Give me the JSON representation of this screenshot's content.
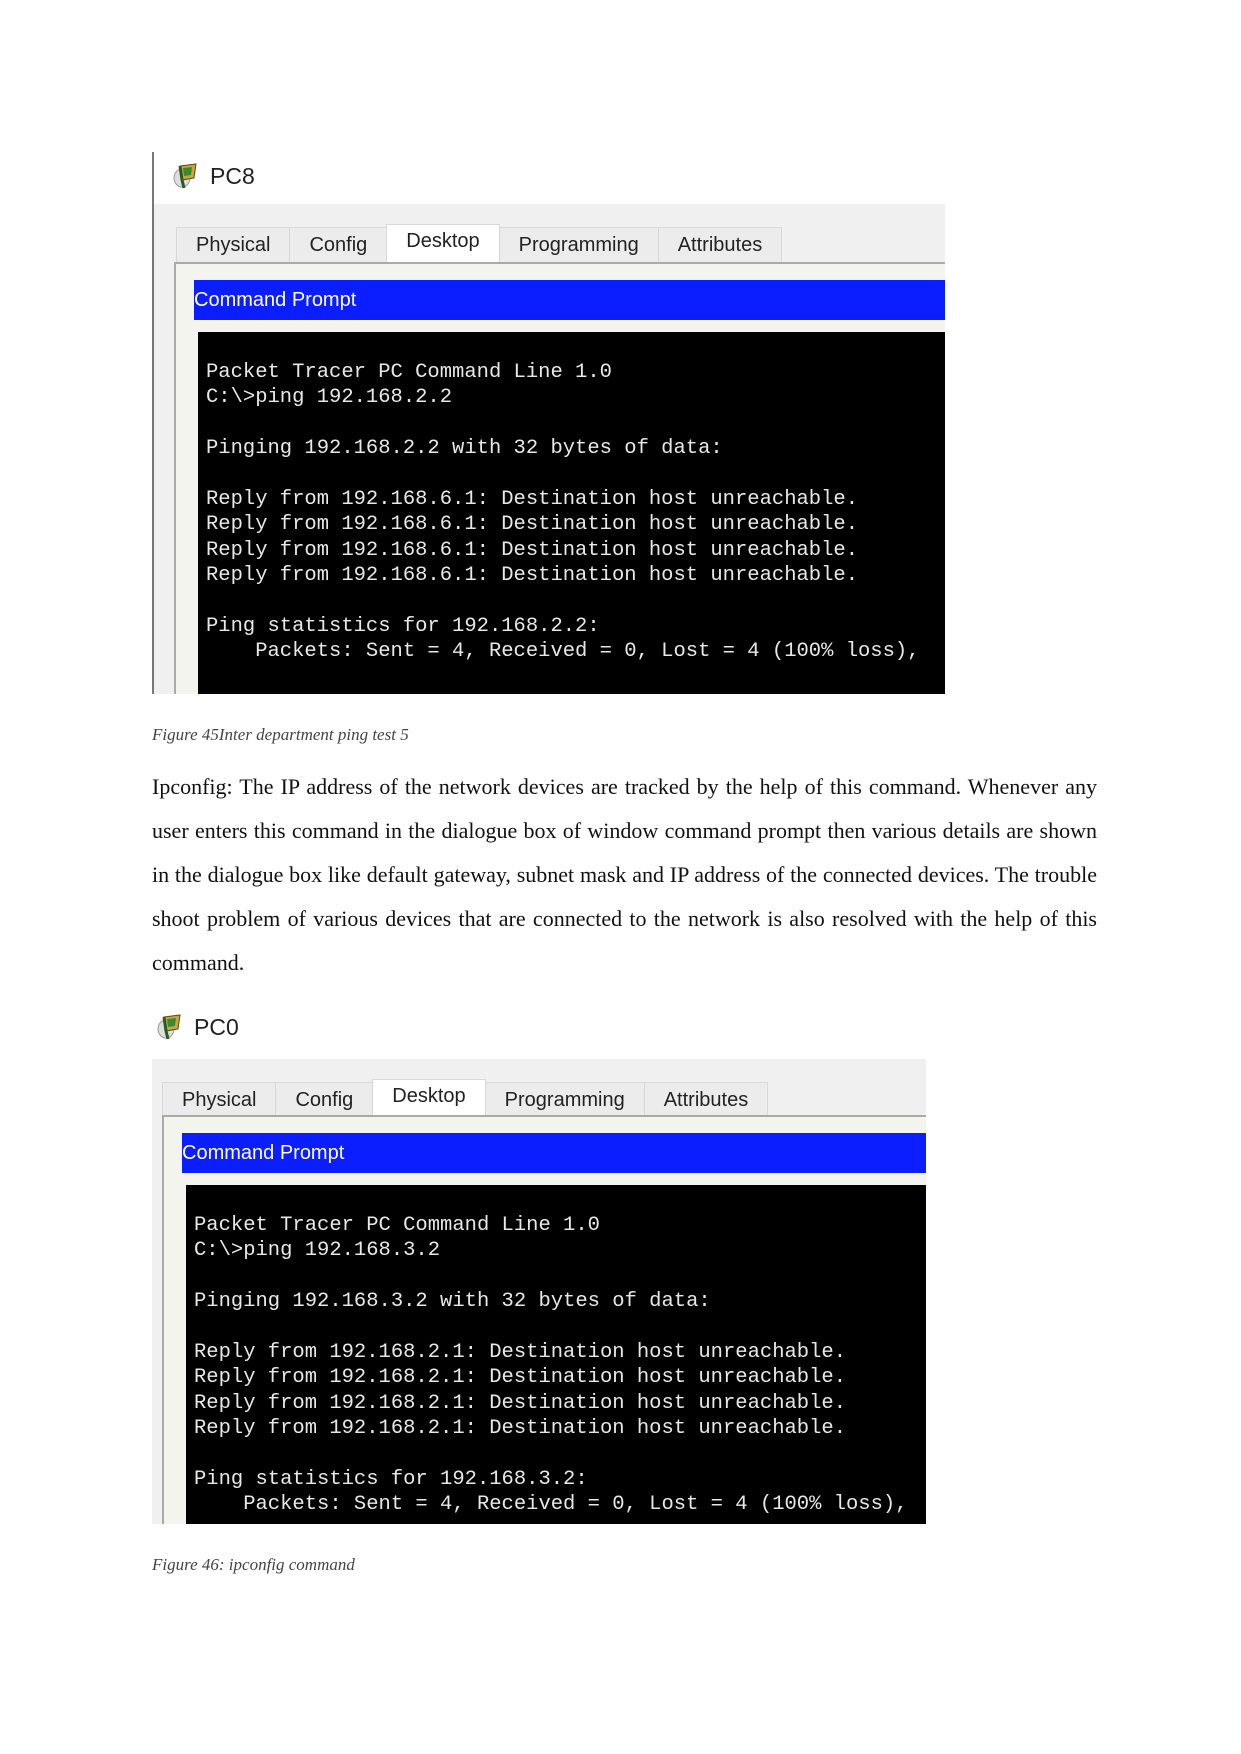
{
  "figures": [
    {
      "device_title": "PC8",
      "tabs": [
        "Physical",
        "Config",
        "Desktop",
        "Programming",
        "Attributes"
      ],
      "active_tab": "Desktop",
      "panel_title": "Command Prompt",
      "terminal_lines": [
        "Packet Tracer PC Command Line 1.0",
        "C:\\>ping 192.168.2.2",
        "",
        "Pinging 192.168.2.2 with 32 bytes of data:",
        "",
        "Reply from 192.168.6.1: Destination host unreachable.",
        "Reply from 192.168.6.1: Destination host unreachable.",
        "Reply from 192.168.6.1: Destination host unreachable.",
        "Reply from 192.168.6.1: Destination host unreachable.",
        "",
        "Ping statistics for 192.168.2.2:",
        "    Packets: Sent = 4, Received = 0, Lost = 4 (100% loss),"
      ],
      "caption": "Figure 45Inter department ping test 5"
    },
    {
      "device_title": "PC0",
      "tabs": [
        "Physical",
        "Config",
        "Desktop",
        "Programming",
        "Attributes"
      ],
      "active_tab": "Desktop",
      "panel_title": "Command Prompt",
      "terminal_lines": [
        "Packet Tracer PC Command Line 1.0",
        "C:\\>ping 192.168.3.2",
        "",
        "Pinging 192.168.3.2 with 32 bytes of data:",
        "",
        "Reply from 192.168.2.1: Destination host unreachable.",
        "Reply from 192.168.2.1: Destination host unreachable.",
        "Reply from 192.168.2.1: Destination host unreachable.",
        "Reply from 192.168.2.1: Destination host unreachable.",
        "",
        "Ping statistics for 192.168.3.2:",
        "    Packets: Sent = 4, Received = 0, Lost = 4 (100% loss),"
      ],
      "caption": "Figure 46: ipconfig command"
    }
  ],
  "paragraph": "Ipconfig: The IP address of the network devices are tracked by the help of this command. Whenever any user enters this command in the dialogue box of window command prompt then various details are shown in the dialogue box like default gateway, subnet mask and IP address of the connected devices. The trouble shoot problem of various devices that are connected to the network is also resolved with the help of this command.",
  "colors": {
    "command_bar": "#0a1eff",
    "terminal_bg": "#000000",
    "terminal_text": "#e8e8e8"
  }
}
